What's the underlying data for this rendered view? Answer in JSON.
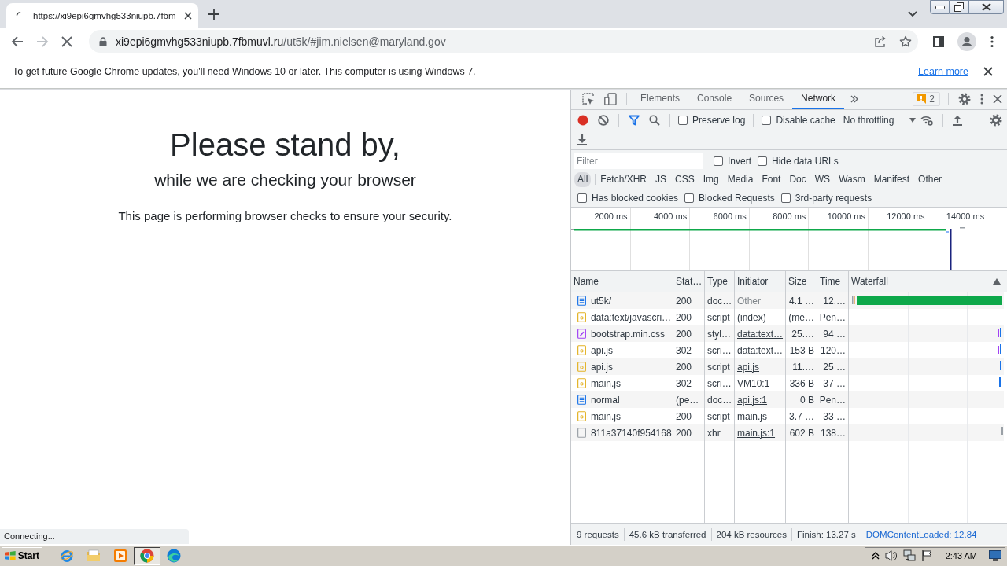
{
  "browser": {
    "loading": true,
    "tab": {
      "title": "https://xi9epi6gmvhg533niupb.7fbm"
    },
    "forward": {
      "disabled": true
    },
    "address": {
      "host": "xi9epi6gmvhg533niupb.7fbmuvl.ru",
      "path": "/ut5k/#jim.nielsen@maryland.gov"
    }
  },
  "infobar": {
    "message": "To get future Google Chrome updates, you'll need Windows 10 or later. This computer is using Windows 7.",
    "link": "Learn more"
  },
  "page": {
    "title": "Please stand by,",
    "subtitle": "while we are checking your browser",
    "text": "This page is performing browser checks to ensure your security.",
    "status": "Connecting..."
  },
  "devtools": {
    "tabs": [
      {
        "label": "Elements",
        "selected": false
      },
      {
        "label": "Console",
        "selected": false
      },
      {
        "label": "Sources",
        "selected": false
      },
      {
        "label": "Network",
        "selected": true
      }
    ],
    "issues": "2",
    "toolbar": {
      "recording": true,
      "options": [
        {
          "label": "Preserve log",
          "checked": false
        },
        {
          "label": "Disable cache",
          "checked": false
        }
      ],
      "throttling": "No throttling"
    },
    "filter": {
      "placeholder": "Filter",
      "options": [
        {
          "label": "Invert",
          "checked": false
        },
        {
          "label": "Hide data URLs",
          "checked": false
        }
      ]
    },
    "types": [
      {
        "label": "All",
        "selected": true
      },
      {
        "label": "Fetch/XHR",
        "selected": false
      },
      {
        "label": "JS",
        "selected": false
      },
      {
        "label": "CSS",
        "selected": false
      },
      {
        "label": "Img",
        "selected": false
      },
      {
        "label": "Media",
        "selected": false
      },
      {
        "label": "Font",
        "selected": false
      },
      {
        "label": "Doc",
        "selected": false
      },
      {
        "label": "WS",
        "selected": false
      },
      {
        "label": "Wasm",
        "selected": false
      },
      {
        "label": "Manifest",
        "selected": false
      },
      {
        "label": "Other",
        "selected": false
      }
    ],
    "blocked_options": [
      {
        "label": "Has blocked cookies",
        "checked": false
      },
      {
        "label": "Blocked Requests",
        "checked": false
      },
      {
        "label": "3rd-party requests",
        "checked": false
      }
    ],
    "overview": {
      "ticks": [
        "2000 ms",
        "4000 ms",
        "6000 ms",
        "8000 ms",
        "10000 ms",
        "12000 ms",
        "14000 ms"
      ]
    },
    "table": {
      "columns": [
        "Name",
        "Stat…",
        "Type",
        "Initiator",
        "Size",
        "Time",
        "Waterfall"
      ],
      "rows": [
        {
          "kind": "document",
          "name": "ut5k/",
          "status": "200",
          "type": "doc…",
          "initiator": "Other",
          "link": false,
          "size": "4.1 …",
          "time": "12.…"
        },
        {
          "kind": "script",
          "name": "data:text/javascri…",
          "status": "200",
          "type": "script",
          "initiator": "(index)",
          "link": true,
          "size": "(me…",
          "time": "Pen…"
        },
        {
          "kind": "stylesheet",
          "name": "bootstrap.min.css",
          "status": "200",
          "type": "styl…",
          "initiator": "data:text…",
          "link": true,
          "size": "25.…",
          "time": "94 …"
        },
        {
          "kind": "script",
          "name": "api.js",
          "status": "302",
          "type": "scri…",
          "initiator": "data:text…",
          "link": true,
          "size": "153 B",
          "time": "120…"
        },
        {
          "kind": "script",
          "name": "api.js",
          "status": "200",
          "type": "script",
          "initiator": "api.js",
          "link": true,
          "size": "11.…",
          "time": "25 …"
        },
        {
          "kind": "script",
          "name": "main.js",
          "status": "302",
          "type": "scri…",
          "initiator": "VM10:1",
          "link": true,
          "size": "336 B",
          "time": "37 …"
        },
        {
          "kind": "document",
          "name": "normal",
          "status": "(pe…",
          "type": "doc…",
          "initiator": "api.js:1",
          "link": true,
          "size": "0 B",
          "time": "Pen…"
        },
        {
          "kind": "script",
          "name": "main.js",
          "status": "200",
          "type": "script",
          "initiator": "main.js",
          "link": true,
          "size": "3.7 …",
          "time": "33 …"
        },
        {
          "kind": "xhr",
          "name": "811a37140f954168",
          "status": "200",
          "type": "xhr",
          "initiator": "main.js:1",
          "link": true,
          "size": "602 B",
          "time": "138…"
        }
      ]
    },
    "summary": [
      {
        "kind": "plain",
        "text": "9 requests"
      },
      {
        "kind": "plain",
        "text": "45.6 kB transferred"
      },
      {
        "kind": "plain",
        "text": "204 kB resources"
      },
      {
        "kind": "plain",
        "text": "Finish: 13.27 s"
      },
      {
        "kind": "dcl",
        "text": "DOMContentLoaded: 12.84"
      }
    ]
  },
  "taskbar": {
    "start": "Start",
    "apps": [
      {
        "kind": "ie",
        "selected": false
      },
      {
        "kind": "folder",
        "selected": false
      },
      {
        "kind": "media",
        "selected": false
      },
      {
        "kind": "chrome",
        "selected": true
      },
      {
        "kind": "edge",
        "selected": false
      }
    ],
    "clock": "2:43 AM"
  }
}
